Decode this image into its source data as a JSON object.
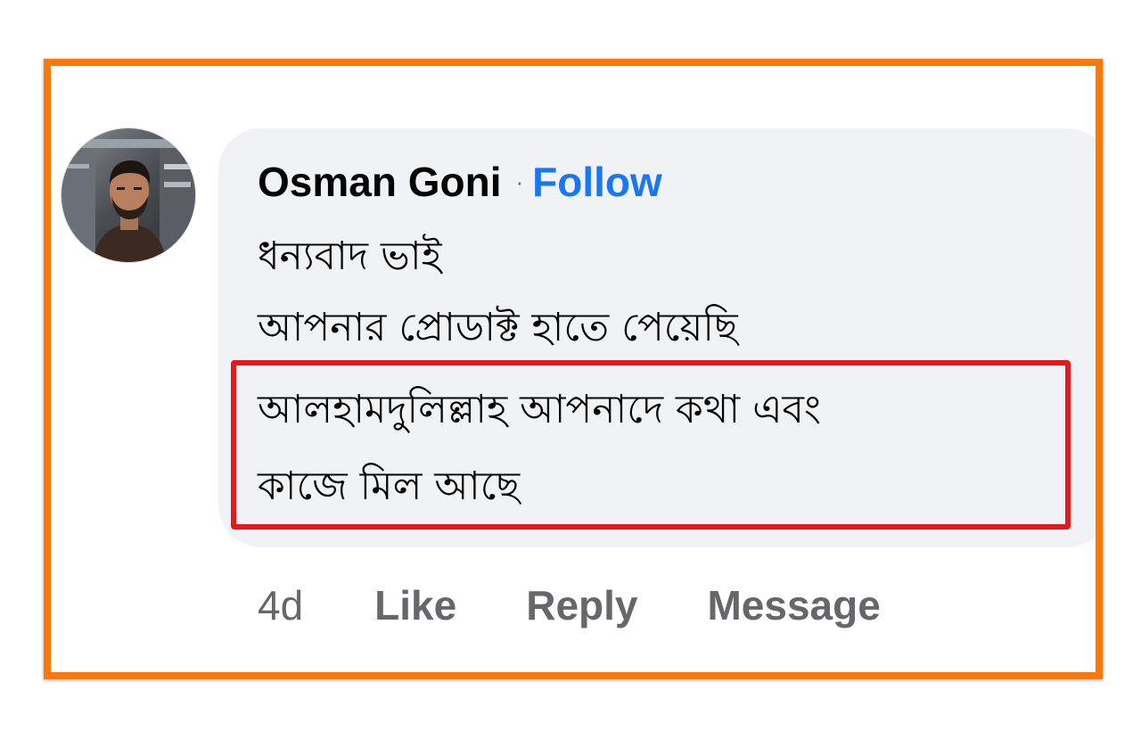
{
  "comment": {
    "author": "Osman Goni",
    "separator": "·",
    "follow_label": "Follow",
    "lines": [
      "ধন্যবাদ ভাই",
      "আপনার প্রোডাক্ট হাতে পেয়েছি",
      "আলহামদুলিল্লাহ আপনাদে কথা এবং",
      "কাজে মিল আছে"
    ]
  },
  "actions": {
    "time": "4d",
    "like_label": "Like",
    "reply_label": "Reply",
    "message_label": "Message"
  },
  "colors": {
    "frame": "#f97a0a",
    "highlight": "#e5191d",
    "follow": "#1877f2",
    "bubble": "#f0f2f5",
    "meta_text": "#65676b"
  }
}
